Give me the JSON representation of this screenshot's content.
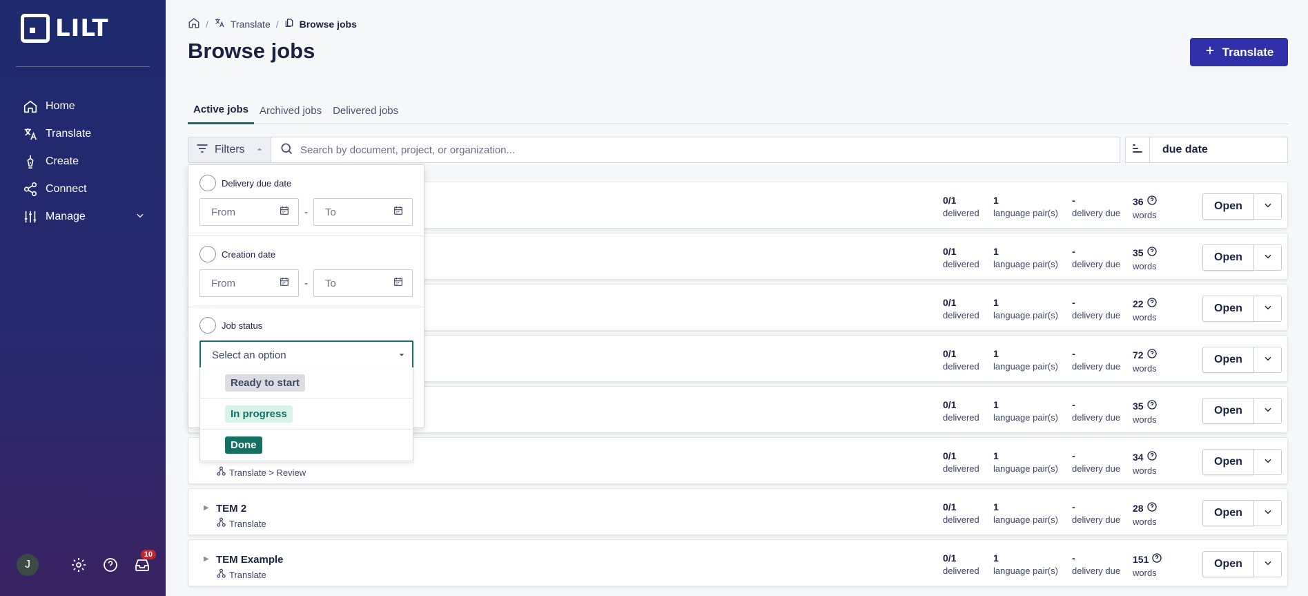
{
  "app": {
    "logo_text": "LILT"
  },
  "sidebar": {
    "items": [
      {
        "label": "Home",
        "icon": "home-icon"
      },
      {
        "label": "Translate",
        "icon": "translate-icon"
      },
      {
        "label": "Create",
        "icon": "pen-icon"
      },
      {
        "label": "Connect",
        "icon": "share-icon"
      },
      {
        "label": "Manage",
        "icon": "sliders-icon"
      }
    ],
    "avatar_initial": "J",
    "notifications_count": "10"
  },
  "breadcrumb": {
    "level1": "Translate",
    "level2": "Browse jobs"
  },
  "header": {
    "title": "Browse jobs",
    "translate_button": "Translate"
  },
  "tabs": [
    {
      "label": "Active jobs",
      "active": true
    },
    {
      "label": "Archived jobs",
      "active": false
    },
    {
      "label": "Delivered jobs",
      "active": false
    }
  ],
  "toolbar": {
    "filters_label": "Filters",
    "search_placeholder": "Search by document, project, or organization...",
    "sort_value": "due date"
  },
  "filters": {
    "delivery_due_date": {
      "label": "Delivery due date",
      "from": "From",
      "to": "To"
    },
    "creation_date": {
      "label": "Creation date",
      "from": "From",
      "to": "To"
    },
    "job_status": {
      "label": "Job status",
      "placeholder": "Select an option",
      "options": [
        "Ready to start",
        "In progress",
        "Done"
      ]
    },
    "dash": "-"
  },
  "stat_labels": {
    "delivered": "delivered",
    "pairs": "language pair(s)",
    "due": "delivery due",
    "words": "words"
  },
  "open_label": "Open",
  "jobs": [
    {
      "name": "",
      "workflow": "",
      "delivered": "0/1",
      "pairs": "1",
      "due": "-",
      "words": "36"
    },
    {
      "name": "",
      "workflow": "",
      "delivered": "0/1",
      "pairs": "1",
      "due": "-",
      "words": "35"
    },
    {
      "name": "",
      "workflow": "",
      "delivered": "0/1",
      "pairs": "1",
      "due": "-",
      "words": "22"
    },
    {
      "name": "",
      "workflow": "",
      "delivered": "0/1",
      "pairs": "1",
      "due": "-",
      "words": "72"
    },
    {
      "name": "",
      "workflow": "",
      "delivered": "0/1",
      "pairs": "1",
      "due": "-",
      "words": "35"
    },
    {
      "name": "",
      "workflow": "Translate > Review",
      "delivered": "0/1",
      "pairs": "1",
      "due": "-",
      "words": "34"
    },
    {
      "name": "TEM 2",
      "workflow": "Translate",
      "delivered": "0/1",
      "pairs": "1",
      "due": "-",
      "words": "28"
    },
    {
      "name": "TEM Example",
      "workflow": "Translate",
      "delivered": "0/1",
      "pairs": "1",
      "due": "-",
      "words": "151"
    }
  ]
}
